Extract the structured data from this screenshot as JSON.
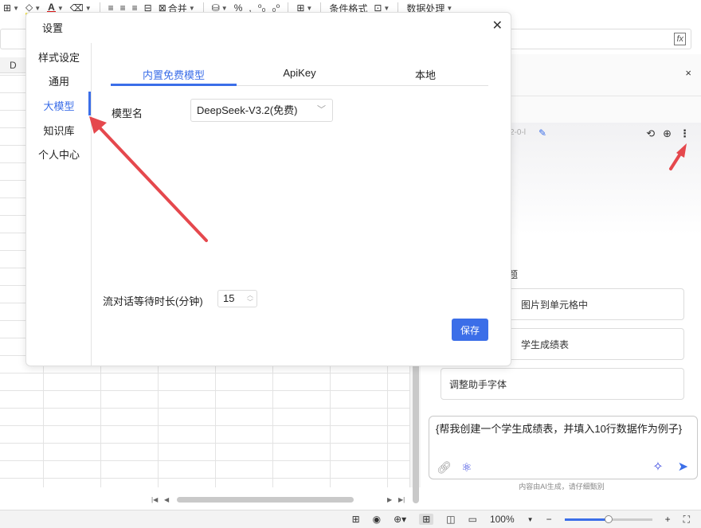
{
  "toolbar": {
    "merge_label": "合并",
    "cond_format_label": "条件格式",
    "data_process_label": "数据处理"
  },
  "grid": {
    "visible_column": "D"
  },
  "dialog": {
    "title": "设置",
    "nav": [
      "样式设定",
      "通用",
      "大模型",
      "知识库",
      "个人中心"
    ],
    "active_nav": "大模型",
    "tabs": [
      "内置免费模型",
      "ApiKey",
      "本地"
    ],
    "active_tab": "内置免费模型",
    "model_label": "模型名",
    "model_value": "DeepSeek-V3.2(免费)",
    "wait_label": "流对话等待时长(分钟)",
    "wait_value": "15",
    "save_label": "保存"
  },
  "assistant": {
    "title_fragment": "2-0-l",
    "suggest_heading_fragment": "题",
    "suggestions": [
      "图片到单元格中",
      "学生成绩表",
      "调整助手字体"
    ],
    "input_text": "{帮我创建一个学生成绩表，并填入10行数据作为例子}",
    "disclaimer": "内容由AI生成，请仔细甄别"
  },
  "status_bar": {
    "zoom": "100%"
  },
  "colors": {
    "accent": "#3b6ee8",
    "annotation_arrow": "#e5484d"
  }
}
